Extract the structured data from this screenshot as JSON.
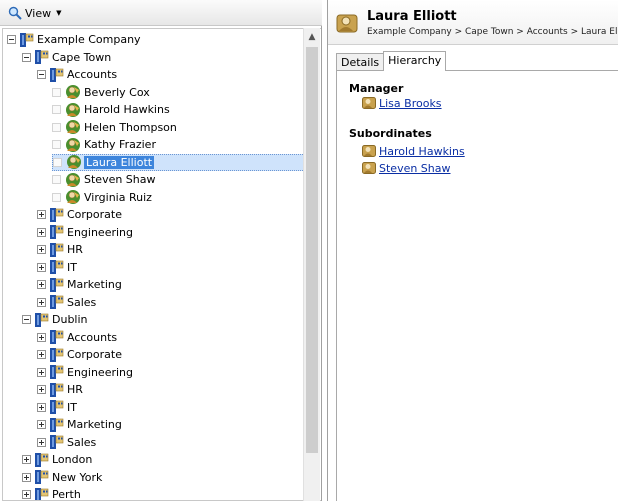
{
  "toolbar": {
    "view_label": "View"
  },
  "tree": [
    {
      "label": "Example Company",
      "type": "ou",
      "level": 0,
      "expander": "minus"
    },
    {
      "label": "Cape Town",
      "type": "ou",
      "level": 1,
      "expander": "minus"
    },
    {
      "label": "Accounts",
      "type": "ou",
      "level": 2,
      "expander": "minus"
    },
    {
      "label": "Beverly Cox",
      "type": "user",
      "level": 3
    },
    {
      "label": "Harold Hawkins",
      "type": "user",
      "level": 3
    },
    {
      "label": "Helen Thompson",
      "type": "user",
      "level": 3
    },
    {
      "label": "Kathy Frazier",
      "type": "user",
      "level": 3
    },
    {
      "label": "Laura Elliott",
      "type": "user",
      "level": 3,
      "selected": true
    },
    {
      "label": "Steven Shaw",
      "type": "user",
      "level": 3
    },
    {
      "label": "Virginia Ruiz",
      "type": "user",
      "level": 3
    },
    {
      "label": "Corporate",
      "type": "ou",
      "level": 2,
      "expander": "plus"
    },
    {
      "label": "Engineering",
      "type": "ou",
      "level": 2,
      "expander": "plus"
    },
    {
      "label": "HR",
      "type": "ou",
      "level": 2,
      "expander": "plus"
    },
    {
      "label": "IT",
      "type": "ou",
      "level": 2,
      "expander": "plus"
    },
    {
      "label": "Marketing",
      "type": "ou",
      "level": 2,
      "expander": "plus"
    },
    {
      "label": "Sales",
      "type": "ou",
      "level": 2,
      "expander": "plus"
    },
    {
      "label": "Dublin",
      "type": "ou",
      "level": 1,
      "expander": "minus"
    },
    {
      "label": "Accounts",
      "type": "ou",
      "level": 2,
      "expander": "plus"
    },
    {
      "label": "Corporate",
      "type": "ou",
      "level": 2,
      "expander": "plus"
    },
    {
      "label": "Engineering",
      "type": "ou",
      "level": 2,
      "expander": "plus"
    },
    {
      "label": "HR",
      "type": "ou",
      "level": 2,
      "expander": "plus"
    },
    {
      "label": "IT",
      "type": "ou",
      "level": 2,
      "expander": "plus"
    },
    {
      "label": "Marketing",
      "type": "ou",
      "level": 2,
      "expander": "plus"
    },
    {
      "label": "Sales",
      "type": "ou",
      "level": 2,
      "expander": "plus"
    },
    {
      "label": "London",
      "type": "ou",
      "level": 1,
      "expander": "plus"
    },
    {
      "label": "New York",
      "type": "ou",
      "level": 1,
      "expander": "plus"
    },
    {
      "label": "Perth",
      "type": "ou",
      "level": 1,
      "expander": "plus"
    }
  ],
  "details": {
    "name": "Laura Elliott",
    "breadcrumb": "Example Company  >  Cape Town  >  Accounts  >  Laura Elliott",
    "tabs": [
      {
        "label": "Details",
        "active": false
      },
      {
        "label": "Hierarchy",
        "active": true
      }
    ],
    "manager_title": "Manager",
    "manager": "Lisa Brooks",
    "subordinates_title": "Subordinates",
    "subordinates": [
      "Harold Hawkins",
      "Steven Shaw"
    ]
  },
  "colors": {
    "selection": "#3d85dc",
    "link": "#0a2ea4"
  },
  "icons": {
    "view": "magnifier-icon",
    "ou": "book-ou-icon",
    "user": "user-avatar-icon"
  }
}
